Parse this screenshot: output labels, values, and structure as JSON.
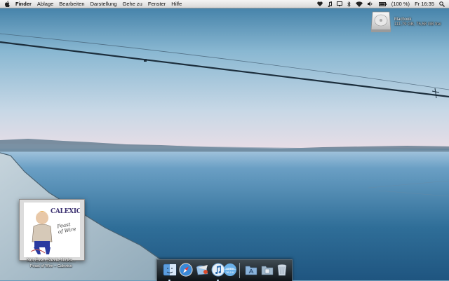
{
  "menubar": {
    "app_name": "Finder",
    "items": [
      "Ablage",
      "Bearbeiten",
      "Darstellung",
      "Gehe zu",
      "Fenster",
      "Hilfe"
    ],
    "battery": "(100 %)",
    "clock": "Fr 16:35",
    "status_icons": [
      "heart-icon",
      "music-note-icon",
      "display-icon",
      "bluetooth-icon",
      "wifi-icon",
      "volume-icon",
      "battery-icon",
      "spotlight-icon"
    ]
  },
  "desktop": {
    "drive_name": "Macbook",
    "drive_info": "111,79 GB, 75,58 GB frei"
  },
  "now_playing": {
    "track": "Not Even Stevie Nicks...",
    "album_artist": "Feast of Wire – Calexico",
    "cover_text": "CALEXICO",
    "cover_script": "Feast of Wire"
  },
  "dock": {
    "items": [
      "finder-icon",
      "safari-icon",
      "mail-icon",
      "itunes-icon",
      "network-meter-icon",
      "applications-folder-icon",
      "documents-folder-icon",
      "trash-icon"
    ],
    "network_meter": [
      "12,5 K",
      "38,0 K"
    ]
  },
  "colors": {
    "sky": "#8ab8d2",
    "water": "#2f6e98",
    "menubar": "#e6e6e6"
  }
}
